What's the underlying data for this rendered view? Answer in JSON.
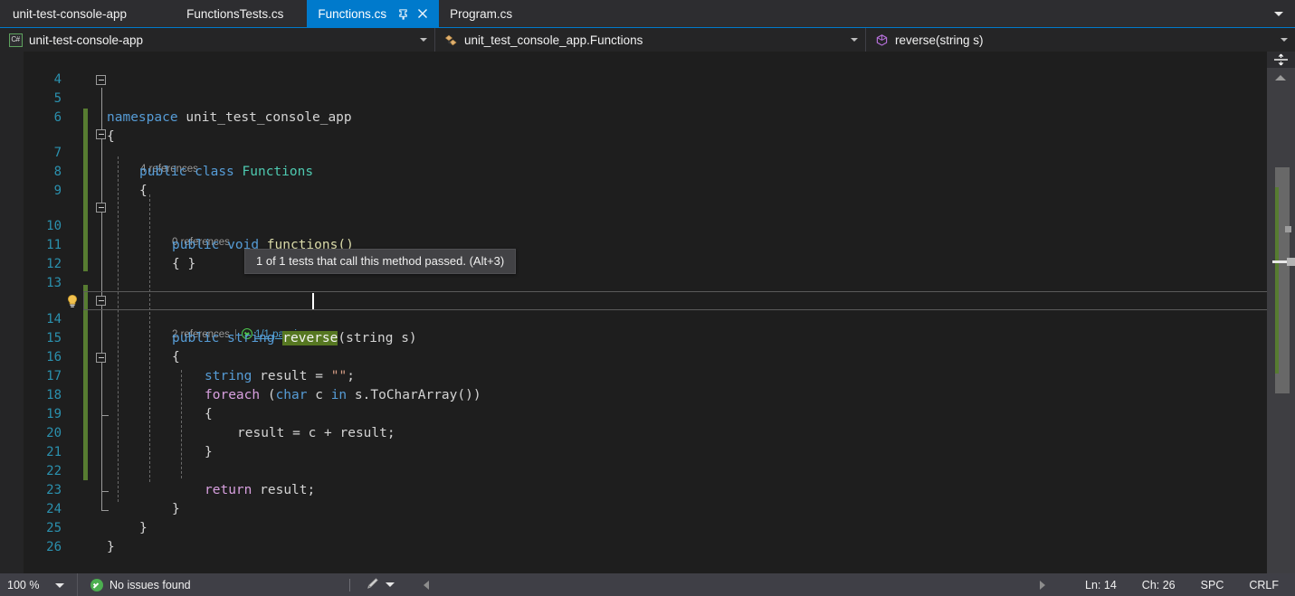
{
  "tabstrip": {
    "tabs": [
      {
        "label": "unit-test-console-app",
        "state": "project"
      },
      {
        "label": "FunctionsTests.cs",
        "state": "inactive"
      },
      {
        "label": "Functions.cs",
        "state": "active",
        "pin_icon": "pin-icon",
        "close_icon": "close-icon"
      },
      {
        "label": "Program.cs",
        "state": "inactive"
      }
    ],
    "overflow_icon": "chevron-down-icon"
  },
  "navbar": {
    "project": {
      "label": "unit-test-console-app",
      "icon": "csharp-project-icon",
      "badge": "C#",
      "caret": "chevron-down-icon"
    },
    "type": {
      "label": "unit_test_console_app.Functions",
      "icon": "class-icon",
      "caret": "chevron-down-icon"
    },
    "member": {
      "label": "reverse(string s)",
      "icon": "method-icon",
      "caret": "chevron-down-icon"
    }
  },
  "editor": {
    "lines": [
      {
        "num": "4",
        "text": ""
      },
      {
        "num": "5",
        "text": "namespace unit_test_console_app"
      },
      {
        "num": "6",
        "text": "{"
      },
      {
        "num": "7",
        "text": "public class Functions"
      },
      {
        "num": "8",
        "text": "{"
      },
      {
        "num": "9",
        "text": ""
      },
      {
        "num": "10",
        "text": "public void functions()"
      },
      {
        "num": "11",
        "text": "{ }"
      },
      {
        "num": "12",
        "text": ""
      },
      {
        "num": "13",
        "text": ""
      },
      {
        "num": "14",
        "text": "public string reverse(string s)"
      },
      {
        "num": "15",
        "text": "{"
      },
      {
        "num": "16",
        "text": "string result = \"\";"
      },
      {
        "num": "17",
        "text": "foreach (char c in s.ToCharArray())"
      },
      {
        "num": "18",
        "text": "{"
      },
      {
        "num": "19",
        "text": "result = c + result;"
      },
      {
        "num": "20",
        "text": "}"
      },
      {
        "num": "21",
        "text": ""
      },
      {
        "num": "22",
        "text": "return result;"
      },
      {
        "num": "23",
        "text": "}"
      },
      {
        "num": "24",
        "text": "}"
      },
      {
        "num": "25",
        "text": "}"
      },
      {
        "num": "26",
        "text": ""
      }
    ],
    "tokens": {
      "kw_namespace": "namespace",
      "ns_name": "unit_test_console_app",
      "kw_public": "public",
      "kw_class": "class",
      "type_functions": "Functions",
      "brace_open": "{",
      "brace_close": "}",
      "brace_pair": "{ }",
      "kw_void": "void",
      "mth_functions": "functions()",
      "kw_string": "string",
      "mth_reverse": "reverse",
      "paren_string_s": "(string s)",
      "var_result": "result",
      "assign": " = ",
      "empty_string": "\"\"",
      "semicolon": ";",
      "kw_foreach": "foreach",
      "foreach_head": "(char c in s.ToCharArray())",
      "kw_char": "char",
      "var_c": "c",
      "kw_in": "in",
      "expr_tochararray": "s.ToCharArray()",
      "stmt_result": "result = c + result;",
      "kw_return": "return",
      "return_expr": "result;"
    },
    "codelens": [
      {
        "line": "7",
        "references": "4 references"
      },
      {
        "line": "10",
        "references": "0 references"
      },
      {
        "line": "14",
        "references": "2 references",
        "separator": "|",
        "test_status": "1/1 passing",
        "status_icon": "test-passed-icon"
      }
    ],
    "tooltip": {
      "text": "1 of 1 tests that call this method passed. (Alt+3)"
    },
    "lightbulb": {
      "icon": "lightbulb-icon",
      "line": "14"
    },
    "selection": {
      "text": "reverse",
      "prefix": "rev",
      "suffix": "erse"
    }
  },
  "scrollbar": {
    "splitter_icon": "split-view-icon",
    "up_arrow_icon": "scroll-up-icon"
  },
  "statusbar": {
    "zoom": "100 %",
    "zoom_caret": "chevron-down-icon",
    "issues_text": "No issues found",
    "issues_icon": "check-circle-icon",
    "pen_icon": "feedback-pen-icon",
    "pen_caret": "chevron-down-icon",
    "prev_icon": "arrow-left-icon",
    "next_icon": "arrow-right-icon",
    "line": "Ln: 14",
    "col": "Ch: 26",
    "spaces": "SPC",
    "eol": "CRLF"
  },
  "colors": {
    "accent": "#007acc",
    "editor_bg": "#1e1e1e",
    "chrome_bg": "#2d2d30",
    "status_bg": "#3f3f46",
    "keyword": "#569cd6",
    "type": "#4ec9b0",
    "string": "#d69d85",
    "control": "#d8a0df",
    "linenum": "#2b91af",
    "change_bar": "#577c31",
    "selection": "#567721"
  }
}
